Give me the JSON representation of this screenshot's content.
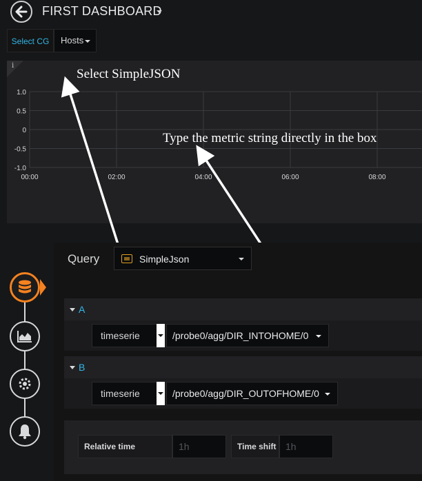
{
  "header": {
    "title": "FIRST DASHBOARD"
  },
  "variables": {
    "label": "Select CG",
    "value": "Hosts"
  },
  "panel": {
    "info": "i"
  },
  "chart_data": {
    "type": "line",
    "title": "",
    "xlabel": "",
    "ylabel": "",
    "x_ticks": [
      "00:00",
      "02:00",
      "04:00",
      "06:00",
      "08:00"
    ],
    "y_ticks": [
      "1.0",
      "0.5",
      "0",
      "-0.5",
      "-1.0"
    ],
    "ylim": [
      -1.0,
      1.0
    ],
    "series": [],
    "grid": true
  },
  "annotations": {
    "datasource_hint": "Select SimpleJSON",
    "metric_hint": "Type the metric string directly in the box",
    "arrow_color": "#ffffff"
  },
  "query": {
    "label": "Query",
    "datasource": "SimpleJson",
    "rows": [
      {
        "letter": "A",
        "type": "timeserie",
        "target": "/probe0/agg/DIR_INTOHOME/0"
      },
      {
        "letter": "B",
        "type": "timeserie",
        "target": "/probe0/agg/DIR_OUTOFHOME/0"
      }
    ]
  },
  "options": {
    "relative_time_label": "Relative time",
    "relative_time_placeholder": "1h",
    "time_shift_label": "Time shift",
    "time_shift_placeholder": "1h"
  },
  "sidebar": {
    "items": [
      {
        "name": "queries",
        "icon": "database-icon",
        "active": true
      },
      {
        "name": "visualization",
        "icon": "area-chart-icon",
        "active": false
      },
      {
        "name": "general",
        "icon": "gear-icon",
        "active": false
      },
      {
        "name": "alert",
        "icon": "bell-icon",
        "active": false
      }
    ]
  },
  "colors": {
    "accent": "#f58220",
    "link": "#33b5e5",
    "background": "#161719"
  }
}
